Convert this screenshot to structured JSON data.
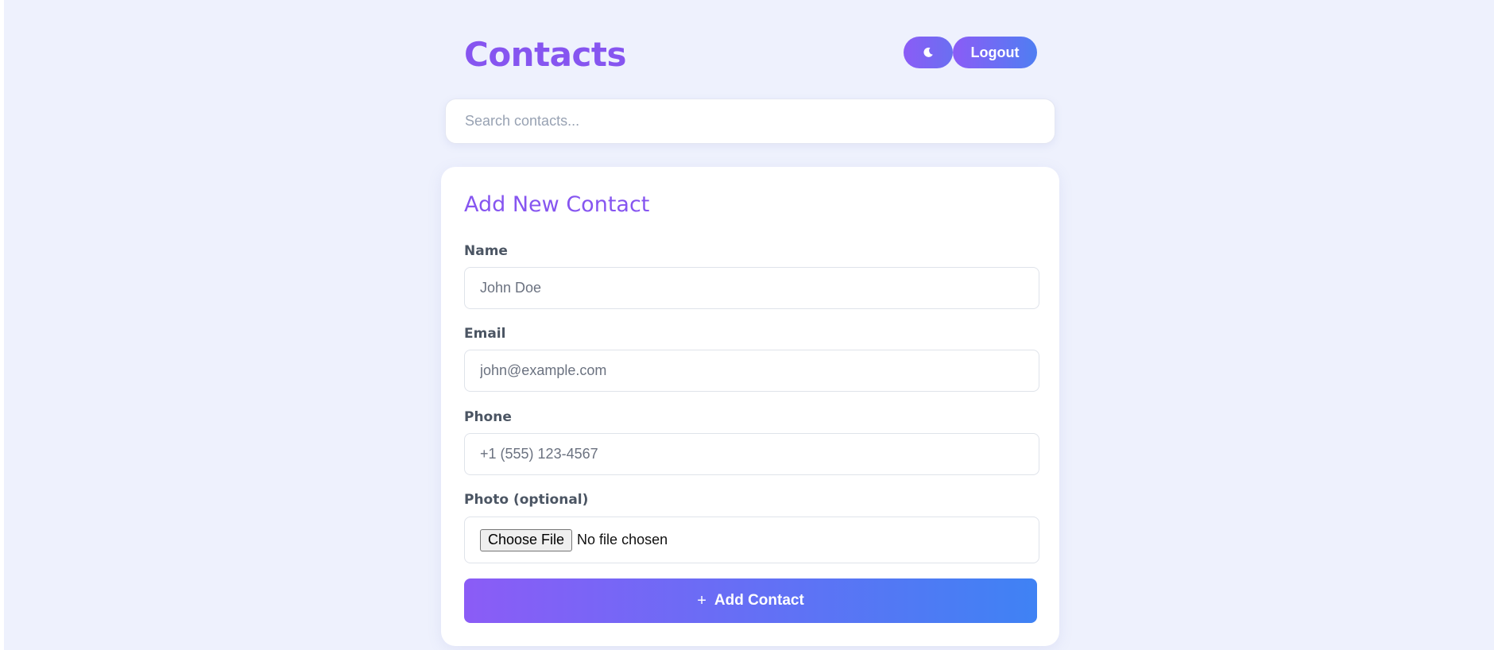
{
  "header": {
    "title": "Contacts",
    "theme_toggle_icon": "moon-icon",
    "logout_label": "Logout"
  },
  "search": {
    "placeholder": "Search contacts..."
  },
  "form": {
    "title": "Add New Contact",
    "name": {
      "label": "Name",
      "placeholder": "John Doe"
    },
    "email": {
      "label": "Email",
      "placeholder": "john@example.com"
    },
    "phone": {
      "label": "Phone",
      "placeholder": "+1 (555) 123-4567"
    },
    "photo": {
      "label": "Photo (optional)",
      "button_label": "Choose File",
      "status": "No file chosen"
    },
    "submit": {
      "icon": "plus-icon",
      "icon_glyph": "+",
      "label": "Add Contact"
    }
  },
  "colors": {
    "background": "#eef1fd",
    "accent_purple": "#8655f0",
    "accent_blue": "#3f82f4"
  }
}
